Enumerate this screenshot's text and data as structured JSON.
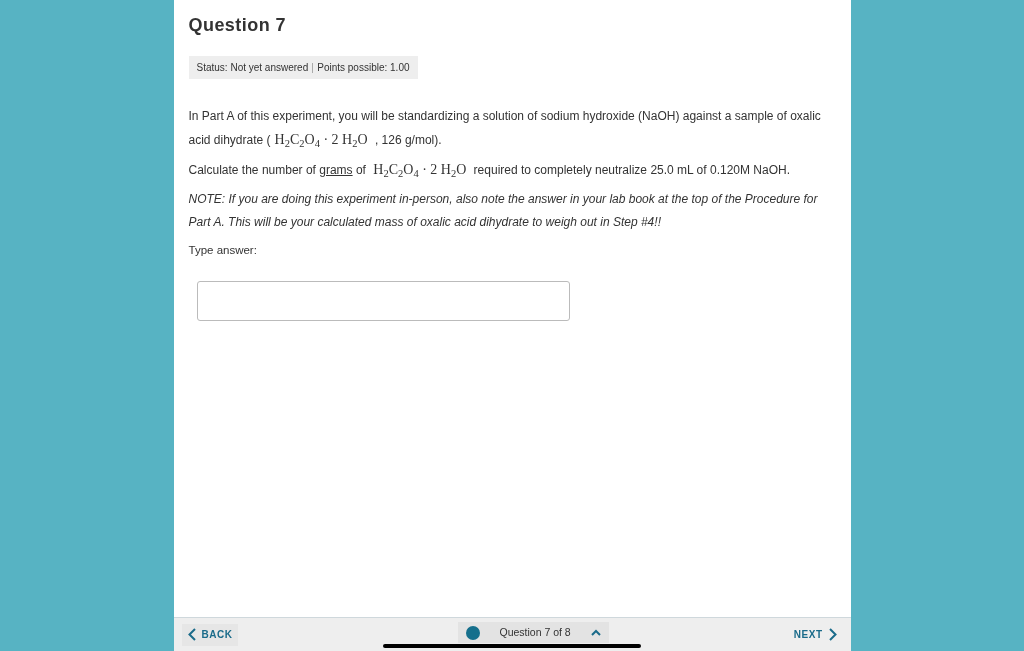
{
  "question": {
    "title": "Question 7",
    "status": "Status: Not yet answered",
    "points": "Points possible: 1.00"
  },
  "paragraphs": [
    {
      "kind": "plain",
      "parts": [
        {
          "kind": "text",
          "text": "In Part A of this experiment, you will be standardizing a solution of sodium hydroxide (NaOH) against a sample of oxalic acid dihydrate ("
        },
        {
          "kind": "formula",
          "text": "H$_{2}$C$_{2}$O$_{4}$ · 2 H$_{2}$O"
        },
        {
          "kind": "text",
          "text": " , 126 g/mol)."
        }
      ]
    },
    {
      "kind": "plain",
      "parts": [
        {
          "kind": "text",
          "text": "Calculate the number of "
        },
        {
          "kind": "underline",
          "text": "grams"
        },
        {
          "kind": "text",
          "text": " of "
        },
        {
          "kind": "formula",
          "text": "H$_{2}$C$_{2}$O$_{4}$ · 2 H$_{2}$O"
        },
        {
          "kind": "text",
          "text": " required to completely neutralize 25.0 mL of 0.120M NaOH."
        }
      ]
    },
    {
      "kind": "italic",
      "parts": [
        {
          "kind": "text",
          "text": "NOTE: If you are doing this experiment in-person, also note the answer in your lab book at the top of the Procedure for Part A. This will be your calculated mass of oxalic acid dihydrate to weigh out in Step #4!!"
        }
      ]
    }
  ],
  "answer": {
    "label": "Type answer:"
  },
  "footer": {
    "back": "BACK",
    "progress": "Question 7 of 8",
    "next": "NEXT"
  }
}
